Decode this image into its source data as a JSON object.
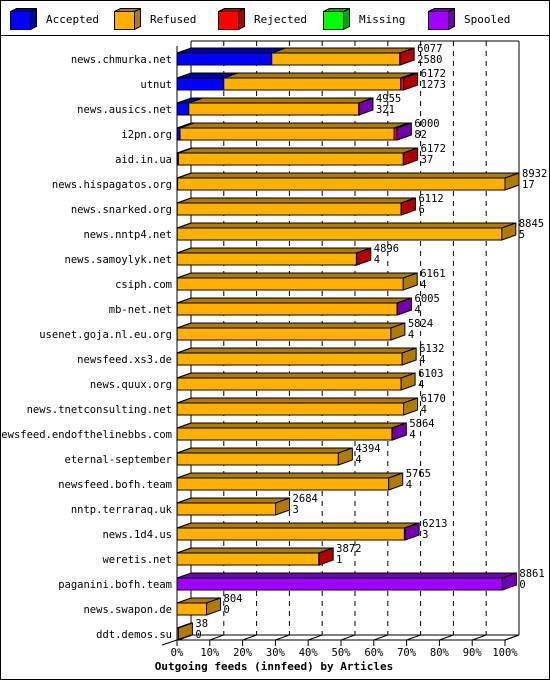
{
  "legend": [
    {
      "key": "accepted",
      "label": "Accepted",
      "color": "#0000ff",
      "side": "#0000a8"
    },
    {
      "key": "refused",
      "label": "Refused",
      "color": "#ffb000",
      "side": "#b07c00"
    },
    {
      "key": "rejected",
      "label": "Rejected",
      "color": "#ff0000",
      "side": "#b00000"
    },
    {
      "key": "missing",
      "label": "Missing",
      "color": "#00ff00",
      "side": "#00a800"
    },
    {
      "key": "spooled",
      "label": "Spooled",
      "color": "#a000ff",
      "side": "#7000b0"
    }
  ],
  "chart_data": {
    "type": "bar",
    "orientation": "horizontal",
    "stacked": true,
    "style": "3d",
    "title": "Outgoing feeds (innfeed) by Articles",
    "xlabel": "Outgoing feeds (innfeed) by Articles",
    "ylabel": "",
    "x_tick_labels": [
      "0%",
      "10%",
      "20%",
      "30%",
      "40%",
      "50%",
      "60%",
      "70%",
      "80%",
      "90%",
      "100%"
    ],
    "xlim_percent": [
      0,
      100
    ],
    "scale_max_total": 8932,
    "grid": "vertical-dashed",
    "legend_position": "top",
    "series": [
      "accepted",
      "refused",
      "rejected",
      "missing",
      "spooled"
    ],
    "categories": [
      "news.chmurka.net",
      "utnut",
      "news.ausics.net",
      "i2pn.org",
      "aid.in.ua",
      "news.hispagatos.org",
      "news.snarked.org",
      "news.nntp4.net",
      "news.samoylyk.net",
      "csiph.com",
      "mb-net.net",
      "usenet.goja.nl.eu.org",
      "newsfeed.xs3.de",
      "news.quux.org",
      "news.tnetconsulting.net",
      "newsfeed.endofthelinebbs.com",
      "eternal-september",
      "newsfeed.bofh.team",
      "nntp.terraraq.uk",
      "news.1d4.us",
      "weretis.net",
      "paganini.bofh.team",
      "news.swapon.de",
      "ddt.demos.su"
    ],
    "rows": [
      {
        "name": "news.chmurka.net",
        "total": 6077,
        "accepted": 2580,
        "refused": 3487,
        "rejected": 10,
        "missing": 0,
        "spooled": 0
      },
      {
        "name": "utnut",
        "total": 6172,
        "accepted": 1273,
        "refused": 4819,
        "rejected": 80,
        "missing": 0,
        "spooled": 0
      },
      {
        "name": "news.ausics.net",
        "total": 4955,
        "accepted": 321,
        "refused": 4630,
        "rejected": 0,
        "missing": 0,
        "spooled": 4
      },
      {
        "name": "i2pn.org",
        "total": 6000,
        "accepted": 82,
        "refused": 5830,
        "rejected": 80,
        "missing": 0,
        "spooled": 8
      },
      {
        "name": "aid.in.ua",
        "total": 6172,
        "accepted": 37,
        "refused": 6125,
        "rejected": 10,
        "missing": 0,
        "spooled": 0
      },
      {
        "name": "news.hispagatos.org",
        "total": 8932,
        "accepted": 17,
        "refused": 8915,
        "rejected": 0,
        "missing": 0,
        "spooled": 0
      },
      {
        "name": "news.snarked.org",
        "total": 6112,
        "accepted": 6,
        "refused": 6096,
        "rejected": 10,
        "missing": 0,
        "spooled": 0
      },
      {
        "name": "news.nntp4.net",
        "total": 8845,
        "accepted": 5,
        "refused": 8840,
        "rejected": 0,
        "missing": 0,
        "spooled": 0
      },
      {
        "name": "news.samoylyk.net",
        "total": 4896,
        "accepted": 4,
        "refused": 4882,
        "rejected": 10,
        "missing": 0,
        "spooled": 0
      },
      {
        "name": "csiph.com",
        "total": 6161,
        "accepted": 4,
        "refused": 6157,
        "rejected": 0,
        "missing": 0,
        "spooled": 0
      },
      {
        "name": "mb-net.net",
        "total": 6005,
        "accepted": 4,
        "refused": 5991,
        "rejected": 0,
        "missing": 0,
        "spooled": 10
      },
      {
        "name": "usenet.goja.nl.eu.org",
        "total": 5824,
        "accepted": 4,
        "refused": 5820,
        "rejected": 0,
        "missing": 0,
        "spooled": 0
      },
      {
        "name": "newsfeed.xs3.de",
        "total": 6132,
        "accepted": 4,
        "refused": 6128,
        "rejected": 0,
        "missing": 0,
        "spooled": 0
      },
      {
        "name": "news.quux.org",
        "total": 6103,
        "accepted": 4,
        "refused": 6099,
        "rejected": 0,
        "missing": 0,
        "spooled": 0
      },
      {
        "name": "news.tnetconsulting.net",
        "total": 6170,
        "accepted": 4,
        "refused": 6166,
        "rejected": 0,
        "missing": 0,
        "spooled": 0
      },
      {
        "name": "newsfeed.endofthelinebbs.com",
        "total": 5864,
        "accepted": 4,
        "refused": 5850,
        "rejected": 0,
        "missing": 0,
        "spooled": 10
      },
      {
        "name": "eternal-september",
        "total": 4394,
        "accepted": 4,
        "refused": 4390,
        "rejected": 0,
        "missing": 0,
        "spooled": 0
      },
      {
        "name": "newsfeed.bofh.team",
        "total": 5765,
        "accepted": 4,
        "refused": 5761,
        "rejected": 0,
        "missing": 0,
        "spooled": 0
      },
      {
        "name": "nntp.terraraq.uk",
        "total": 2684,
        "accepted": 3,
        "refused": 2681,
        "rejected": 0,
        "missing": 0,
        "spooled": 0
      },
      {
        "name": "news.1d4.us",
        "total": 6213,
        "accepted": 3,
        "refused": 6190,
        "rejected": 0,
        "missing": 0,
        "spooled": 20
      },
      {
        "name": "weretis.net",
        "total": 3872,
        "accepted": 1,
        "refused": 3861,
        "rejected": 10,
        "missing": 0,
        "spooled": 0
      },
      {
        "name": "paganini.bofh.team",
        "total": 8861,
        "accepted": 0,
        "refused": 0,
        "rejected": 0,
        "missing": 0,
        "spooled": 8861
      },
      {
        "name": "news.swapon.de",
        "total": 804,
        "accepted": 0,
        "refused": 804,
        "rejected": 0,
        "missing": 0,
        "spooled": 0
      },
      {
        "name": "ddt.demos.su",
        "total": 38,
        "accepted": 0,
        "refused": 38,
        "rejected": 0,
        "missing": 0,
        "spooled": 0
      }
    ]
  }
}
